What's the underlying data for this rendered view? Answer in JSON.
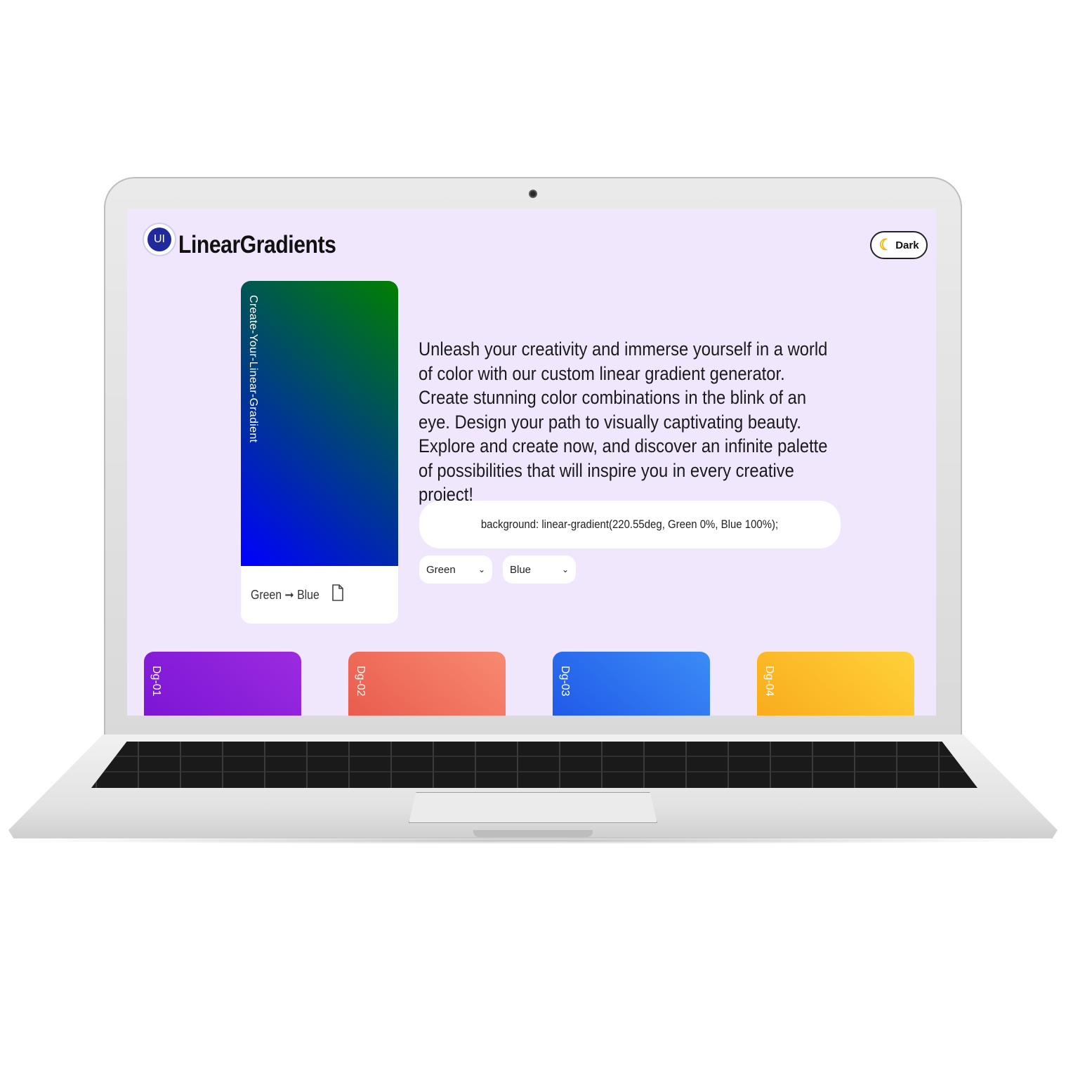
{
  "brand": {
    "logo_text": "UI",
    "title": "LinearGradients"
  },
  "theme_toggle": {
    "icon": "moon-icon",
    "label": "Dark"
  },
  "preview": {
    "vertical_label": "Create-Your-Linear-Gradient",
    "footer_text": "Green ➞ Blue",
    "copy_icon": "document-icon",
    "gradient_angle": "220.55deg",
    "color_from": "Green",
    "color_to": "Blue"
  },
  "description": "Unleash your creativity and immerse yourself in a world of color with our custom linear gradient generator. Create stunning color combinations in the blink of an eye. Design your path to visually captivating beauty. Explore and create now, and discover an infinite palette of possibilities that will inspire you in every creative project!",
  "code_output": "background: linear-gradient(220.55deg, Green 0%, Blue 100%);",
  "selects": {
    "from": {
      "selected": "Green"
    },
    "to": {
      "selected": "Blue"
    }
  },
  "gradient_cards": [
    {
      "label": "Dg-01",
      "from": "#7a14d4",
      "to": "#9b2be0"
    },
    {
      "label": "Dg-02",
      "from": "#e8594a",
      "to": "#f88a72"
    },
    {
      "label": "Dg-03",
      "from": "#1f56e8",
      "to": "#3b8cf6"
    },
    {
      "label": "Dg-04",
      "from": "#f9a91b",
      "to": "#ffd23a"
    }
  ],
  "colors": {
    "screen_background": "#f0e7fc",
    "logo_blue": "#1f2a9c",
    "moon_yellow": "#f4b400"
  }
}
